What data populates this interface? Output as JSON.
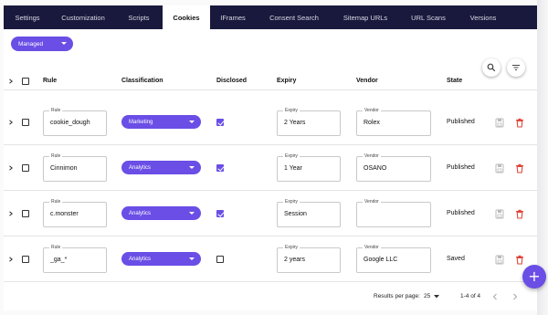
{
  "tabs": [
    {
      "label": "Settings",
      "active": false
    },
    {
      "label": "Customization",
      "active": false
    },
    {
      "label": "Scripts",
      "active": false
    },
    {
      "label": "Cookies",
      "active": true
    },
    {
      "label": "IFrames",
      "active": false
    },
    {
      "label": "Consent Search",
      "active": false
    },
    {
      "label": "Sitemap URLs",
      "active": false
    },
    {
      "label": "URL Scans",
      "active": false
    },
    {
      "label": "Versions",
      "active": false
    }
  ],
  "filter": {
    "selected": "Managed"
  },
  "toolbar": {
    "search_icon": "search-icon",
    "filter_icon": "filter-icon"
  },
  "table": {
    "headers": {
      "rule": "Rule",
      "classification": "Classification",
      "disclosed": "Disclosed",
      "expiry": "Expiry",
      "vendor": "Vendor",
      "state": "State"
    },
    "field_labels": {
      "rule": "Rule",
      "expiry": "Expiry",
      "vendor": "Vendor"
    },
    "rows": [
      {
        "rule": "cookie_dough",
        "classification": "Marketing",
        "disclosed": true,
        "expiry": "2 Years",
        "vendor": "Rolex",
        "state": "Published"
      },
      {
        "rule": "Cinnimon",
        "classification": "Analytics",
        "disclosed": true,
        "expiry": "1 Year",
        "vendor": "OSANO",
        "state": "Published"
      },
      {
        "rule": "c.monster",
        "classification": "Analytics",
        "disclosed": true,
        "expiry": "Session",
        "vendor": "",
        "state": "Published"
      },
      {
        "rule": "_ga_*",
        "classification": "Analytics",
        "disclosed": false,
        "expiry": "2 years",
        "vendor": "Google LLC",
        "state": "Saved"
      }
    ]
  },
  "footer": {
    "results_per_page_label": "Results per page:",
    "results_per_page": "25",
    "range": "1-4 of 4"
  },
  "fab": {
    "label": "+"
  },
  "colors": {
    "accent": "#6a4ee6",
    "tabbar": "#19193d",
    "delete": "#e0463a"
  }
}
